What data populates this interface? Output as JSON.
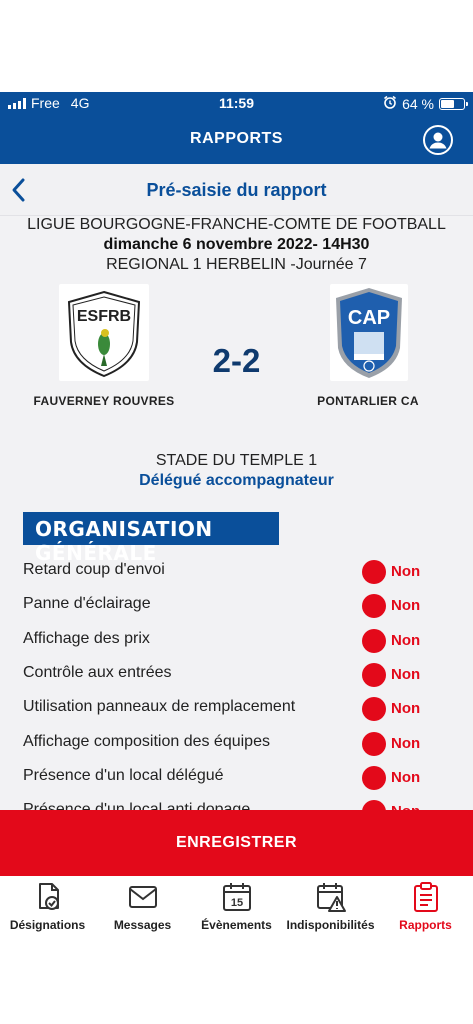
{
  "status": {
    "carrier": "Free",
    "network": "4G",
    "time": "11:59",
    "battery": "64 %",
    "battery_level": 0.64
  },
  "header": {
    "title": "RAPPORTS"
  },
  "subheader": {
    "title": "Pré-saisie du rapport"
  },
  "match": {
    "league": "LIGUE BOURGOGNE-FRANCHE-COMTE DE FOOTBALL",
    "datetime": "dimanche 6 novembre 2022- 14H30",
    "competition": "REGIONAL 1 HERBELIN -Journée 7",
    "home_team": "FAUVERNEY ROUVRES",
    "away_team": "PONTARLIER CA",
    "home_logo_text": "ESFRB",
    "away_logo_text": "CAP",
    "score": "2-2",
    "stadium": "STADE DU TEMPLE 1",
    "role": "Délégué accompagnateur"
  },
  "section": {
    "title": "ORGANISATION GÉNÉRALE",
    "items": [
      {
        "label": "Retard coup d'envoi",
        "value": "Non"
      },
      {
        "label": "Panne d'éclairage",
        "value": "Non"
      },
      {
        "label": "Affichage des prix",
        "value": "Non"
      },
      {
        "label": "Contrôle aux entrées",
        "value": "Non"
      },
      {
        "label": "Utilisation panneaux de remplacement",
        "value": "Non"
      },
      {
        "label": "Affichage composition des équipes",
        "value": "Non"
      },
      {
        "label": "Présence d'un local délégué",
        "value": "Non"
      },
      {
        "label": "Présence d'un local anti dopage",
        "value": "Non"
      }
    ]
  },
  "save_label": "ENREGISTRER",
  "tabs": [
    {
      "label": "Désignations",
      "icon": "document-check-icon"
    },
    {
      "label": "Messages",
      "icon": "envelope-icon"
    },
    {
      "label": "Évènements",
      "icon": "calendar-icon",
      "day": "15"
    },
    {
      "label": "Indisponibilités",
      "icon": "calendar-warning-icon"
    },
    {
      "label": "Rapports",
      "icon": "clipboard-icon",
      "active": true
    }
  ],
  "colors": {
    "primary": "#0a4f9a",
    "accent": "#e3091a",
    "background": "#f2f2f4"
  }
}
